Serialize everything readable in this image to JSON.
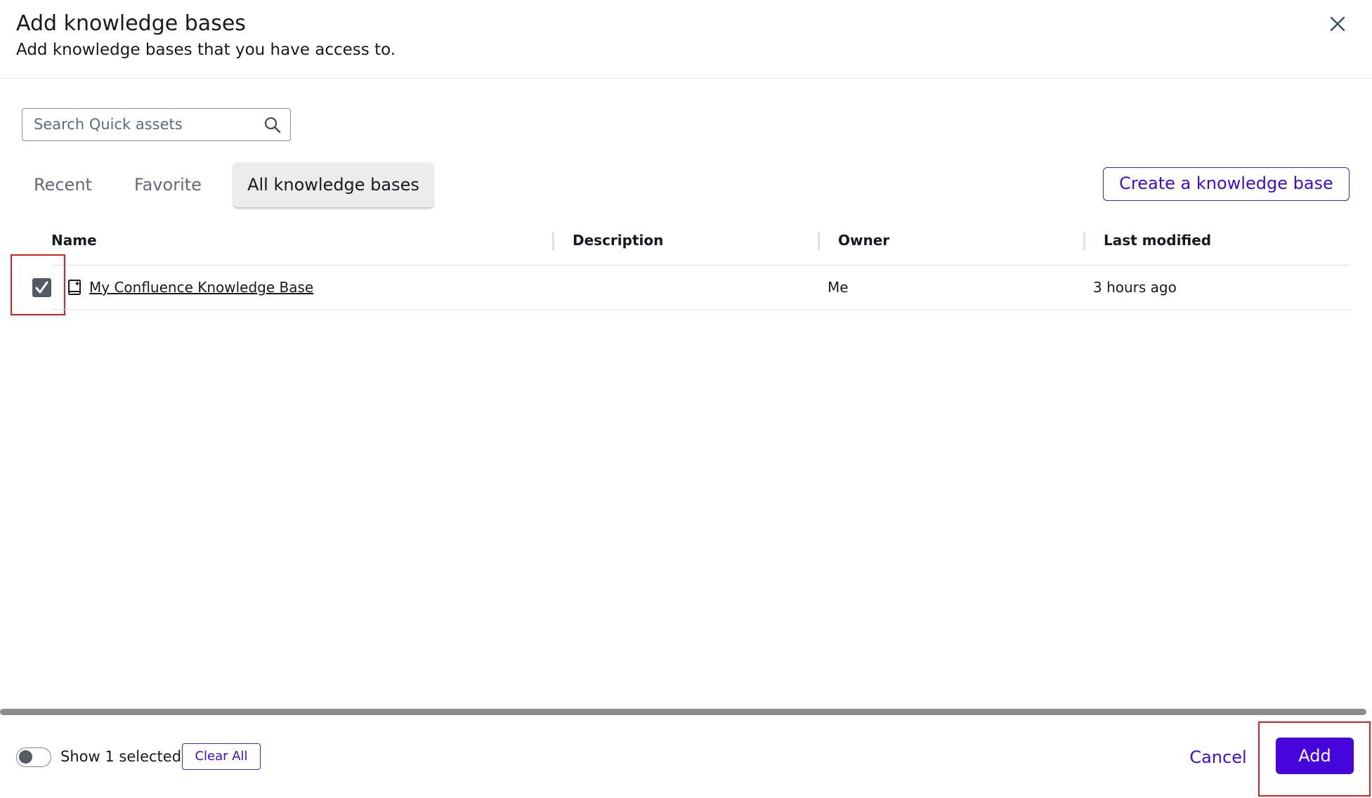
{
  "dialog": {
    "title": "Add knowledge bases",
    "subtitle": "Add knowledge bases that you have access to.",
    "close_icon": "close-icon"
  },
  "search": {
    "placeholder": "Search Quick assets",
    "value": "",
    "icon": "search-icon"
  },
  "tabs": [
    {
      "label": "Recent",
      "selected": false
    },
    {
      "label": "Favorite",
      "selected": false
    },
    {
      "label": "All knowledge bases",
      "selected": true
    }
  ],
  "create_button": {
    "label": "Create a knowledge base"
  },
  "table": {
    "columns": [
      "Name",
      "Description",
      "Owner",
      "Last modified"
    ],
    "rows": [
      {
        "selected": true,
        "icon": "knowledge-base-icon",
        "name": "My Confluence Knowledge Base",
        "description": "",
        "owner": "Me",
        "last_modified": "3 hours ago"
      }
    ]
  },
  "footer": {
    "toggle_on": false,
    "show_selected_label": "Show 1 selected",
    "clear_all_label": "Clear All",
    "cancel_label": "Cancel",
    "add_label": "Add"
  },
  "colors": {
    "accent": "#4505db",
    "highlight": "#e0201c"
  }
}
